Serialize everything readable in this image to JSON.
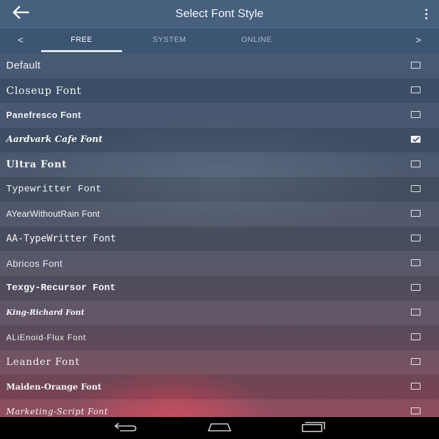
{
  "appbar": {
    "title": "Select Font Style",
    "back_icon": "arrow-left-icon",
    "menu_icon": "more-vert-icon"
  },
  "tabs": {
    "left_arrow": "<",
    "right_arrow": ">",
    "items": [
      {
        "label": "FREE",
        "selected": true
      },
      {
        "label": "SYSTEM",
        "selected": false
      },
      {
        "label": "ONLINE",
        "selected": false
      }
    ]
  },
  "fonts": [
    {
      "label": "Default",
      "checked": false
    },
    {
      "label": "Closeup Font",
      "checked": false
    },
    {
      "label": "Panefresco Font",
      "checked": false
    },
    {
      "label": "Aardvark Cafe Font",
      "checked": true
    },
    {
      "label": "Ultra Font",
      "checked": false
    },
    {
      "label": "Typewritter Font",
      "checked": false
    },
    {
      "label": "AYearWithoutRain Font",
      "checked": false
    },
    {
      "label": "AA-TypeWritter Font",
      "checked": false
    },
    {
      "label": "Abricos Font",
      "checked": false
    },
    {
      "label": "Texgy-Recursor Font",
      "checked": false
    },
    {
      "label": "King-Richard Font",
      "checked": false
    },
    {
      "label": "ALiEnoid-Flux Font",
      "checked": false
    },
    {
      "label": "Leander Font",
      "checked": false
    },
    {
      "label": "Maiden-Orange Font",
      "checked": false
    },
    {
      "label": "Marketing-Script Font",
      "checked": false
    }
  ],
  "navbar": {
    "back_icon": "nav-back-icon",
    "home_icon": "nav-home-icon",
    "recents_icon": "nav-recents-icon"
  },
  "colors": {
    "appbar": "#46607e",
    "tabbar": "#3b5573",
    "accent_glow": "#e1465a"
  }
}
